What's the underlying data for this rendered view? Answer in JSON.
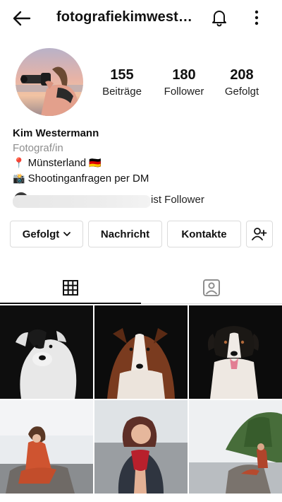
{
  "header": {
    "username": "fotografiekimwest…",
    "icons": [
      "back-arrow-icon",
      "bell-icon",
      "more-vertical-icon"
    ]
  },
  "profile": {
    "stats": [
      {
        "value": "155",
        "label": "Beiträge"
      },
      {
        "value": "180",
        "label": "Follower"
      },
      {
        "value": "208",
        "label": "Gefolgt"
      }
    ],
    "name": "Kim Westermann",
    "category": "Fotograf/in",
    "location_emoji": "📍",
    "location_text": "Münsterland",
    "flag_emoji": "🇩🇪",
    "camera_emoji": "📸",
    "shooting_text": "Shootinganfragen per DM",
    "followed_by_text": "ist Follower"
  },
  "actions": {
    "following_label": "Gefolgt",
    "message_label": "Nachricht",
    "contacts_label": "Kontakte"
  },
  "tabs": [
    {
      "name": "grid",
      "icon": "grid-icon",
      "active": true
    },
    {
      "name": "tagged",
      "icon": "tagged-person-icon",
      "active": false
    }
  ],
  "colors": {
    "border": "#dbdbdb",
    "text_secondary": "#8e8e8e",
    "active_tab": "#111111"
  }
}
